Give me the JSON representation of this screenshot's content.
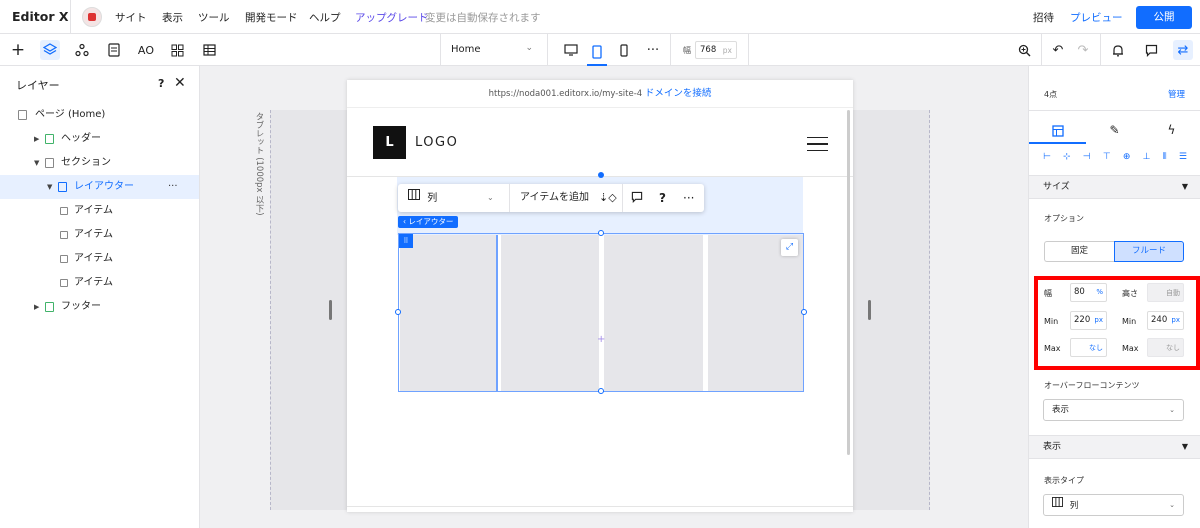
{
  "topbar": {
    "brand": "Editor X",
    "menu": [
      "サイト",
      "表示",
      "ツール",
      "開発モード",
      "ヘルプ"
    ],
    "upgrade": "アップグレード",
    "autosave": "変更は自動保存されます",
    "invite": "招待",
    "preview": "プレビュー",
    "publish": "公開"
  },
  "toolbar": {
    "page": "Home",
    "width_label": "幅",
    "width_value": "768",
    "width_unit": "px"
  },
  "layers_panel": {
    "title": "レイヤー",
    "help": "?",
    "close": "✕",
    "items": [
      {
        "label": "ページ (Home)"
      },
      {
        "label": "ヘッダー"
      },
      {
        "label": "セクション"
      },
      {
        "label": "レイアウター",
        "more": "···"
      },
      {
        "label": "アイテム"
      },
      {
        "label": "アイテム"
      },
      {
        "label": "アイテム"
      },
      {
        "label": "アイテム"
      },
      {
        "label": "フッター"
      }
    ]
  },
  "canvas": {
    "tablet_label": "タブレット (1000px 以下)",
    "url": "https://noda001.editorx.io/my-site-4",
    "connect_domain": "ドメインを接続",
    "logo_letter": "L",
    "logo_text": "LOGO",
    "float_bar": {
      "display_mode": "列",
      "add_item": "アイテムを追加",
      "help": "?"
    },
    "layouter_tag": "‹ レイアウター",
    "plus": "+"
  },
  "inspector": {
    "count": "4点",
    "manage": "管理",
    "size_section": "サイズ",
    "options_label": "オプション",
    "fixed": "固定",
    "fluid": "フルード",
    "width_label": "幅",
    "width_value": "80",
    "width_unit": "%",
    "height_label": "高さ",
    "height_value": "自動",
    "min_label": "Min",
    "min_width_value": "220",
    "min_width_unit": "px",
    "min_height_label": "Min",
    "min_height_value": "240",
    "min_height_unit": "px",
    "max_label": "Max",
    "max_width_value": "なし",
    "max_height_label": "Max",
    "max_height_value": "なし",
    "overflow_label": "オーバーフローコンテンツ",
    "overflow_value": "表示",
    "display_section": "表示",
    "display_type_label": "表示タイプ",
    "display_type_value": "列"
  }
}
